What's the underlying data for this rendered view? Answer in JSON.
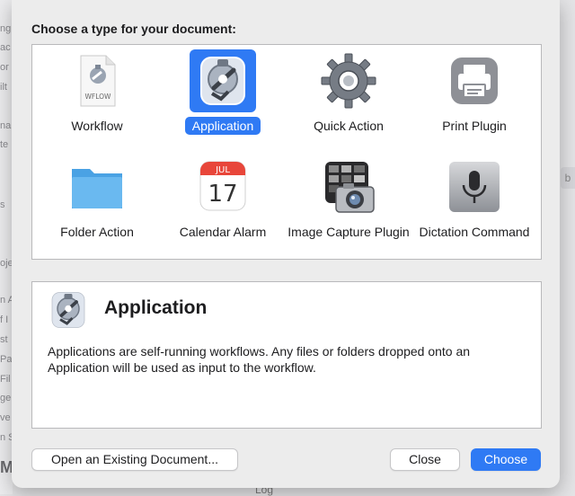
{
  "background": {
    "fragments": [
      "ng",
      "ac",
      "or",
      "ilt",
      "na",
      "te",
      "s",
      "oje",
      "n A",
      "f I",
      "st",
      "Pa",
      "Fil",
      "ge",
      "ve",
      "n S",
      "M"
    ],
    "right_chip": "b",
    "bottom_text": "Log"
  },
  "dialog": {
    "heading": "Choose a type for your document:",
    "types": [
      {
        "label": "Workflow",
        "icon": "workflow-document-icon",
        "doc_tag": "WFLOW"
      },
      {
        "label": "Application",
        "icon": "automator-robot-icon",
        "selected": true
      },
      {
        "label": "Quick Action",
        "icon": "gear-icon"
      },
      {
        "label": "Print Plugin",
        "icon": "printer-icon"
      },
      {
        "label": "Folder Action",
        "icon": "folder-icon"
      },
      {
        "label": "Calendar Alarm",
        "icon": "calendar-icon",
        "month": "JUL",
        "day": "17"
      },
      {
        "label": "Image Capture Plugin",
        "icon": "camera-icon"
      },
      {
        "label": "Dictation Command",
        "icon": "microphone-icon"
      }
    ],
    "description": {
      "title": "Application",
      "text": "Applications are self-running workflows. Any files or folders dropped onto an Application will be used as input to the workflow."
    },
    "buttons": {
      "open_existing": "Open an Existing Document...",
      "close": "Close",
      "choose": "Choose"
    }
  },
  "colors": {
    "accent": "#2f7af4",
    "folder": "#5fb0ec",
    "calendar_red": "#e8463a"
  }
}
